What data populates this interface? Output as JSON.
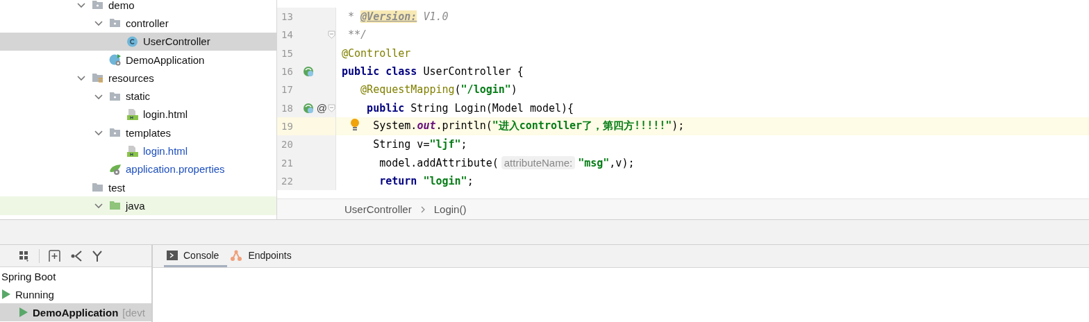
{
  "project_tree": [
    {
      "label": "demo",
      "kind": "package",
      "expanded": true,
      "selected": false,
      "added": false,
      "children": [
        {
          "label": "controller",
          "kind": "package",
          "expanded": true,
          "selected": false,
          "added": false,
          "children": [
            {
              "label": "UserController",
              "kind": "class",
              "selected": true,
              "added": false
            }
          ]
        },
        {
          "label": "DemoApplication",
          "kind": "spring-app",
          "selected": false,
          "added": false
        }
      ]
    },
    {
      "label": "resources",
      "kind": "resources",
      "expanded": true,
      "selected": false,
      "added": false,
      "children": [
        {
          "label": "static",
          "kind": "package",
          "expanded": true,
          "selected": false,
          "added": false,
          "children": [
            {
              "label": "login.html",
              "kind": "html",
              "selected": false,
              "added": false
            }
          ]
        },
        {
          "label": "templates",
          "kind": "package",
          "expanded": true,
          "selected": false,
          "added": false,
          "children": [
            {
              "label": "login.html",
              "kind": "html",
              "selected": false,
              "added": true
            }
          ]
        },
        {
          "label": "application.properties",
          "kind": "properties",
          "selected": false,
          "added": true
        }
      ]
    },
    {
      "label": "test",
      "kind": "folder",
      "selected": false,
      "added": false,
      "children": [
        {
          "label": "java",
          "kind": "test-source",
          "expanded": true,
          "selected": false,
          "added": false,
          "highlighted": true
        }
      ]
    }
  ],
  "editor": {
    "lines": [
      {
        "number": "13",
        "current": false,
        "tokens": [
          {
            "kind": "comment",
            "text": " * "
          },
          {
            "kind": "doc-tag",
            "text": "@Version:"
          },
          {
            "kind": "comment",
            "text": " V1.0"
          }
        ]
      },
      {
        "number": "14",
        "current": false,
        "fold": true,
        "tokens": [
          {
            "kind": "comment",
            "text": " **/"
          }
        ]
      },
      {
        "number": "15",
        "current": false,
        "tokens": [
          {
            "kind": "annotation",
            "text": "@Controller"
          }
        ]
      },
      {
        "number": "16",
        "current": false,
        "bean": true,
        "tokens": [
          {
            "kind": "keyword",
            "text": "public class "
          },
          {
            "kind": "plain",
            "text": "UserController {"
          }
        ]
      },
      {
        "number": "17",
        "current": false,
        "tokens": [
          {
            "kind": "annotation",
            "text": "   @RequestMapping"
          },
          {
            "kind": "plain",
            "text": "("
          },
          {
            "kind": "string",
            "text": "\"/login\""
          },
          {
            "kind": "plain",
            "text": ")"
          }
        ]
      },
      {
        "number": "18",
        "current": false,
        "fold": true,
        "bean": true,
        "symbol": "@",
        "tokens": [
          {
            "kind": "keyword",
            "text": "    public "
          },
          {
            "kind": "plain",
            "text": "String Login(Model model){"
          }
        ]
      },
      {
        "number": "19",
        "current": true,
        "bulb": true,
        "tokens": [
          {
            "kind": "plain",
            "text": "     System."
          },
          {
            "kind": "field",
            "text": "out"
          },
          {
            "kind": "plain",
            "text": ".println("
          },
          {
            "kind": "string",
            "text": "\"进入controller了，第四方!!!!!\""
          },
          {
            "kind": "plain",
            "text": ");"
          }
        ]
      },
      {
        "number": "20",
        "current": false,
        "tokens": [
          {
            "kind": "plain",
            "text": "     String v="
          },
          {
            "kind": "string",
            "text": "\"ljf\""
          },
          {
            "kind": "plain",
            "text": ";"
          }
        ]
      },
      {
        "number": "21",
        "current": false,
        "tokens": [
          {
            "kind": "plain",
            "text": "      model.addAttribute("
          },
          {
            "kind": "hint",
            "text": "attributeName:"
          },
          {
            "kind": "string",
            "text": "\"msg\""
          },
          {
            "kind": "plain",
            "text": ",v);"
          }
        ]
      },
      {
        "number": "22",
        "current": false,
        "tokens": [
          {
            "kind": "keyword",
            "text": "      return "
          },
          {
            "kind": "string",
            "text": "\"login\""
          },
          {
            "kind": "plain",
            "text": ";"
          }
        ]
      }
    ],
    "breadcrumbs": [
      "UserController",
      "Login()"
    ]
  },
  "run_panel": {
    "tree": [
      {
        "label": "Spring Boot",
        "kind": "group",
        "selected": false
      },
      {
        "label": "Running",
        "kind": "status",
        "selected": false
      },
      {
        "label": "DemoApplication",
        "kind": "app",
        "selected": true,
        "suffix": "[devt"
      }
    ]
  },
  "tool_tabs": [
    {
      "label": "Console",
      "kind": "console",
      "selected": true
    },
    {
      "label": "Endpoints",
      "kind": "endpoints",
      "selected": false
    }
  ]
}
